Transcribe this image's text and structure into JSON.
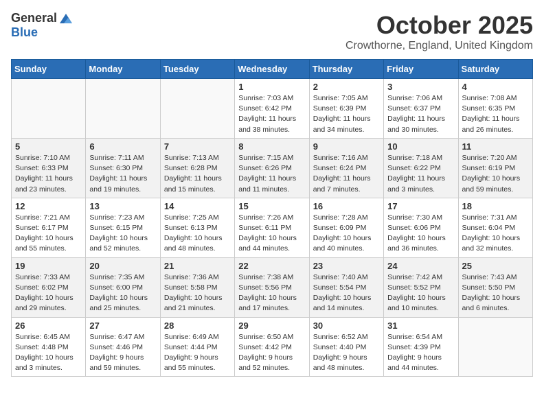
{
  "logo": {
    "general": "General",
    "blue": "Blue"
  },
  "title": {
    "month": "October 2025",
    "location": "Crowthorne, England, United Kingdom"
  },
  "weekdays": [
    "Sunday",
    "Monday",
    "Tuesday",
    "Wednesday",
    "Thursday",
    "Friday",
    "Saturday"
  ],
  "weeks": [
    [
      {
        "day": "",
        "info": ""
      },
      {
        "day": "",
        "info": ""
      },
      {
        "day": "",
        "info": ""
      },
      {
        "day": "1",
        "info": "Sunrise: 7:03 AM\nSunset: 6:42 PM\nDaylight: 11 hours\nand 38 minutes."
      },
      {
        "day": "2",
        "info": "Sunrise: 7:05 AM\nSunset: 6:39 PM\nDaylight: 11 hours\nand 34 minutes."
      },
      {
        "day": "3",
        "info": "Sunrise: 7:06 AM\nSunset: 6:37 PM\nDaylight: 11 hours\nand 30 minutes."
      },
      {
        "day": "4",
        "info": "Sunrise: 7:08 AM\nSunset: 6:35 PM\nDaylight: 11 hours\nand 26 minutes."
      }
    ],
    [
      {
        "day": "5",
        "info": "Sunrise: 7:10 AM\nSunset: 6:33 PM\nDaylight: 11 hours\nand 23 minutes."
      },
      {
        "day": "6",
        "info": "Sunrise: 7:11 AM\nSunset: 6:30 PM\nDaylight: 11 hours\nand 19 minutes."
      },
      {
        "day": "7",
        "info": "Sunrise: 7:13 AM\nSunset: 6:28 PM\nDaylight: 11 hours\nand 15 minutes."
      },
      {
        "day": "8",
        "info": "Sunrise: 7:15 AM\nSunset: 6:26 PM\nDaylight: 11 hours\nand 11 minutes."
      },
      {
        "day": "9",
        "info": "Sunrise: 7:16 AM\nSunset: 6:24 PM\nDaylight: 11 hours\nand 7 minutes."
      },
      {
        "day": "10",
        "info": "Sunrise: 7:18 AM\nSunset: 6:22 PM\nDaylight: 11 hours\nand 3 minutes."
      },
      {
        "day": "11",
        "info": "Sunrise: 7:20 AM\nSunset: 6:19 PM\nDaylight: 10 hours\nand 59 minutes."
      }
    ],
    [
      {
        "day": "12",
        "info": "Sunrise: 7:21 AM\nSunset: 6:17 PM\nDaylight: 10 hours\nand 55 minutes."
      },
      {
        "day": "13",
        "info": "Sunrise: 7:23 AM\nSunset: 6:15 PM\nDaylight: 10 hours\nand 52 minutes."
      },
      {
        "day": "14",
        "info": "Sunrise: 7:25 AM\nSunset: 6:13 PM\nDaylight: 10 hours\nand 48 minutes."
      },
      {
        "day": "15",
        "info": "Sunrise: 7:26 AM\nSunset: 6:11 PM\nDaylight: 10 hours\nand 44 minutes."
      },
      {
        "day": "16",
        "info": "Sunrise: 7:28 AM\nSunset: 6:09 PM\nDaylight: 10 hours\nand 40 minutes."
      },
      {
        "day": "17",
        "info": "Sunrise: 7:30 AM\nSunset: 6:06 PM\nDaylight: 10 hours\nand 36 minutes."
      },
      {
        "day": "18",
        "info": "Sunrise: 7:31 AM\nSunset: 6:04 PM\nDaylight: 10 hours\nand 32 minutes."
      }
    ],
    [
      {
        "day": "19",
        "info": "Sunrise: 7:33 AM\nSunset: 6:02 PM\nDaylight: 10 hours\nand 29 minutes."
      },
      {
        "day": "20",
        "info": "Sunrise: 7:35 AM\nSunset: 6:00 PM\nDaylight: 10 hours\nand 25 minutes."
      },
      {
        "day": "21",
        "info": "Sunrise: 7:36 AM\nSunset: 5:58 PM\nDaylight: 10 hours\nand 21 minutes."
      },
      {
        "day": "22",
        "info": "Sunrise: 7:38 AM\nSunset: 5:56 PM\nDaylight: 10 hours\nand 17 minutes."
      },
      {
        "day": "23",
        "info": "Sunrise: 7:40 AM\nSunset: 5:54 PM\nDaylight: 10 hours\nand 14 minutes."
      },
      {
        "day": "24",
        "info": "Sunrise: 7:42 AM\nSunset: 5:52 PM\nDaylight: 10 hours\nand 10 minutes."
      },
      {
        "day": "25",
        "info": "Sunrise: 7:43 AM\nSunset: 5:50 PM\nDaylight: 10 hours\nand 6 minutes."
      }
    ],
    [
      {
        "day": "26",
        "info": "Sunrise: 6:45 AM\nSunset: 4:48 PM\nDaylight: 10 hours\nand 3 minutes."
      },
      {
        "day": "27",
        "info": "Sunrise: 6:47 AM\nSunset: 4:46 PM\nDaylight: 9 hours\nand 59 minutes."
      },
      {
        "day": "28",
        "info": "Sunrise: 6:49 AM\nSunset: 4:44 PM\nDaylight: 9 hours\nand 55 minutes."
      },
      {
        "day": "29",
        "info": "Sunrise: 6:50 AM\nSunset: 4:42 PM\nDaylight: 9 hours\nand 52 minutes."
      },
      {
        "day": "30",
        "info": "Sunrise: 6:52 AM\nSunset: 4:40 PM\nDaylight: 9 hours\nand 48 minutes."
      },
      {
        "day": "31",
        "info": "Sunrise: 6:54 AM\nSunset: 4:39 PM\nDaylight: 9 hours\nand 44 minutes."
      },
      {
        "day": "",
        "info": ""
      }
    ]
  ]
}
